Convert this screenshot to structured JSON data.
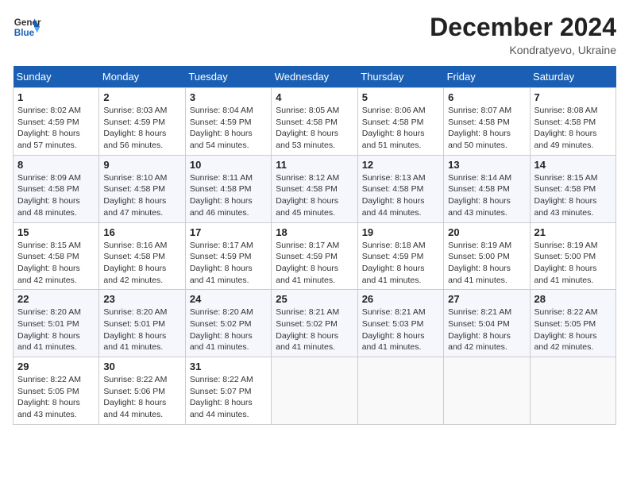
{
  "header": {
    "logo_line1": "General",
    "logo_line2": "Blue",
    "month": "December 2024",
    "location": "Kondratyevo, Ukraine"
  },
  "weekdays": [
    "Sunday",
    "Monday",
    "Tuesday",
    "Wednesday",
    "Thursday",
    "Friday",
    "Saturday"
  ],
  "weeks": [
    [
      {
        "day": "1",
        "sunrise": "8:02 AM",
        "sunset": "4:59 PM",
        "daylight": "8 hours and 57 minutes."
      },
      {
        "day": "2",
        "sunrise": "8:03 AM",
        "sunset": "4:59 PM",
        "daylight": "8 hours and 56 minutes."
      },
      {
        "day": "3",
        "sunrise": "8:04 AM",
        "sunset": "4:59 PM",
        "daylight": "8 hours and 54 minutes."
      },
      {
        "day": "4",
        "sunrise": "8:05 AM",
        "sunset": "4:58 PM",
        "daylight": "8 hours and 53 minutes."
      },
      {
        "day": "5",
        "sunrise": "8:06 AM",
        "sunset": "4:58 PM",
        "daylight": "8 hours and 51 minutes."
      },
      {
        "day": "6",
        "sunrise": "8:07 AM",
        "sunset": "4:58 PM",
        "daylight": "8 hours and 50 minutes."
      },
      {
        "day": "7",
        "sunrise": "8:08 AM",
        "sunset": "4:58 PM",
        "daylight": "8 hours and 49 minutes."
      }
    ],
    [
      {
        "day": "8",
        "sunrise": "8:09 AM",
        "sunset": "4:58 PM",
        "daylight": "8 hours and 48 minutes."
      },
      {
        "day": "9",
        "sunrise": "8:10 AM",
        "sunset": "4:58 PM",
        "daylight": "8 hours and 47 minutes."
      },
      {
        "day": "10",
        "sunrise": "8:11 AM",
        "sunset": "4:58 PM",
        "daylight": "8 hours and 46 minutes."
      },
      {
        "day": "11",
        "sunrise": "8:12 AM",
        "sunset": "4:58 PM",
        "daylight": "8 hours and 45 minutes."
      },
      {
        "day": "12",
        "sunrise": "8:13 AM",
        "sunset": "4:58 PM",
        "daylight": "8 hours and 44 minutes."
      },
      {
        "day": "13",
        "sunrise": "8:14 AM",
        "sunset": "4:58 PM",
        "daylight": "8 hours and 43 minutes."
      },
      {
        "day": "14",
        "sunrise": "8:15 AM",
        "sunset": "4:58 PM",
        "daylight": "8 hours and 43 minutes."
      }
    ],
    [
      {
        "day": "15",
        "sunrise": "8:15 AM",
        "sunset": "4:58 PM",
        "daylight": "8 hours and 42 minutes."
      },
      {
        "day": "16",
        "sunrise": "8:16 AM",
        "sunset": "4:58 PM",
        "daylight": "8 hours and 42 minutes."
      },
      {
        "day": "17",
        "sunrise": "8:17 AM",
        "sunset": "4:59 PM",
        "daylight": "8 hours and 41 minutes."
      },
      {
        "day": "18",
        "sunrise": "8:17 AM",
        "sunset": "4:59 PM",
        "daylight": "8 hours and 41 minutes."
      },
      {
        "day": "19",
        "sunrise": "8:18 AM",
        "sunset": "4:59 PM",
        "daylight": "8 hours and 41 minutes."
      },
      {
        "day": "20",
        "sunrise": "8:19 AM",
        "sunset": "5:00 PM",
        "daylight": "8 hours and 41 minutes."
      },
      {
        "day": "21",
        "sunrise": "8:19 AM",
        "sunset": "5:00 PM",
        "daylight": "8 hours and 41 minutes."
      }
    ],
    [
      {
        "day": "22",
        "sunrise": "8:20 AM",
        "sunset": "5:01 PM",
        "daylight": "8 hours and 41 minutes."
      },
      {
        "day": "23",
        "sunrise": "8:20 AM",
        "sunset": "5:01 PM",
        "daylight": "8 hours and 41 minutes."
      },
      {
        "day": "24",
        "sunrise": "8:20 AM",
        "sunset": "5:02 PM",
        "daylight": "8 hours and 41 minutes."
      },
      {
        "day": "25",
        "sunrise": "8:21 AM",
        "sunset": "5:02 PM",
        "daylight": "8 hours and 41 minutes."
      },
      {
        "day": "26",
        "sunrise": "8:21 AM",
        "sunset": "5:03 PM",
        "daylight": "8 hours and 41 minutes."
      },
      {
        "day": "27",
        "sunrise": "8:21 AM",
        "sunset": "5:04 PM",
        "daylight": "8 hours and 42 minutes."
      },
      {
        "day": "28",
        "sunrise": "8:22 AM",
        "sunset": "5:05 PM",
        "daylight": "8 hours and 42 minutes."
      }
    ],
    [
      {
        "day": "29",
        "sunrise": "8:22 AM",
        "sunset": "5:05 PM",
        "daylight": "8 hours and 43 minutes."
      },
      {
        "day": "30",
        "sunrise": "8:22 AM",
        "sunset": "5:06 PM",
        "daylight": "8 hours and 44 minutes."
      },
      {
        "day": "31",
        "sunrise": "8:22 AM",
        "sunset": "5:07 PM",
        "daylight": "8 hours and 44 minutes."
      },
      null,
      null,
      null,
      null
    ]
  ],
  "labels": {
    "sunrise": "Sunrise:",
    "sunset": "Sunset:",
    "daylight": "Daylight:"
  }
}
